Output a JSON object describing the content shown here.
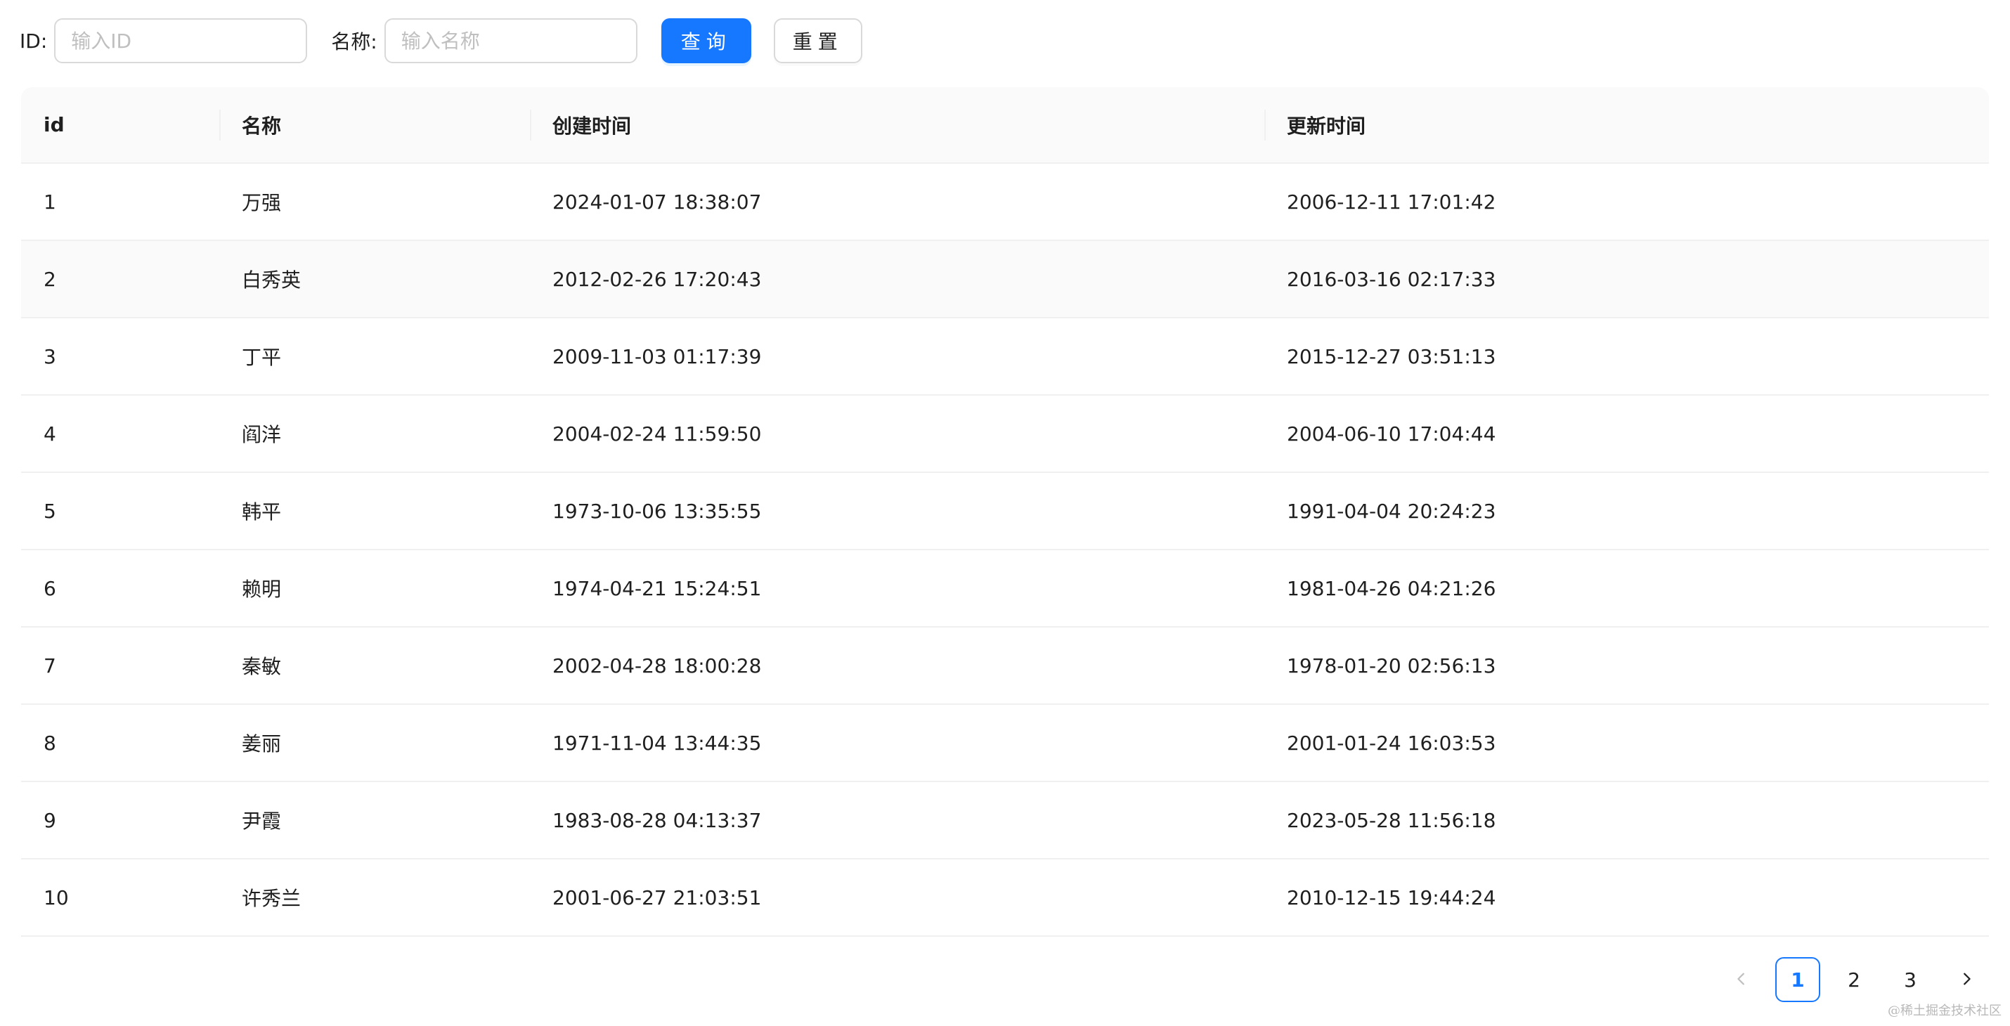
{
  "search": {
    "id_label": "ID:",
    "id_placeholder": "输入ID",
    "id_value": "",
    "name_label": "名称:",
    "name_placeholder": "输入名称",
    "name_value": "",
    "query_button": "查询",
    "reset_button": "重置"
  },
  "table": {
    "columns": [
      "id",
      "名称",
      "创建时间",
      "更新时间"
    ],
    "rows": [
      [
        "1",
        "万强",
        "2024-01-07 18:38:07",
        "2006-12-11 17:01:42"
      ],
      [
        "2",
        "白秀英",
        "2012-02-26 17:20:43",
        "2016-03-16 02:17:33"
      ],
      [
        "3",
        "丁平",
        "2009-11-03 01:17:39",
        "2015-12-27 03:51:13"
      ],
      [
        "4",
        "阎洋",
        "2004-02-24 11:59:50",
        "2004-06-10 17:04:44"
      ],
      [
        "5",
        "韩平",
        "1973-10-06 13:35:55",
        "1991-04-04 20:24:23"
      ],
      [
        "6",
        "赖明",
        "1974-04-21 15:24:51",
        "1981-04-26 04:21:26"
      ],
      [
        "7",
        "秦敏",
        "2002-04-28 18:00:28",
        "1978-01-20 02:56:13"
      ],
      [
        "8",
        "姜丽",
        "1971-11-04 13:44:35",
        "2001-01-24 16:03:53"
      ],
      [
        "9",
        "尹霞",
        "1983-08-28 04:13:37",
        "2023-05-28 11:56:18"
      ],
      [
        "10",
        "许秀兰",
        "2001-06-27 21:03:51",
        "2010-12-15 19:44:24"
      ]
    ],
    "hovered_row": 2
  },
  "pagination": {
    "pages": [
      "1",
      "2",
      "3"
    ],
    "current_page": "1",
    "prev_icon": "chevron-left-icon",
    "next_icon": "chevron-right-icon"
  },
  "watermark": "@稀土掘金技术社区",
  "colors": {
    "primary": "#1677ff",
    "header_bg": "#fafafa",
    "border": "#f0f0f0",
    "placeholder": "#bfbfbf"
  }
}
